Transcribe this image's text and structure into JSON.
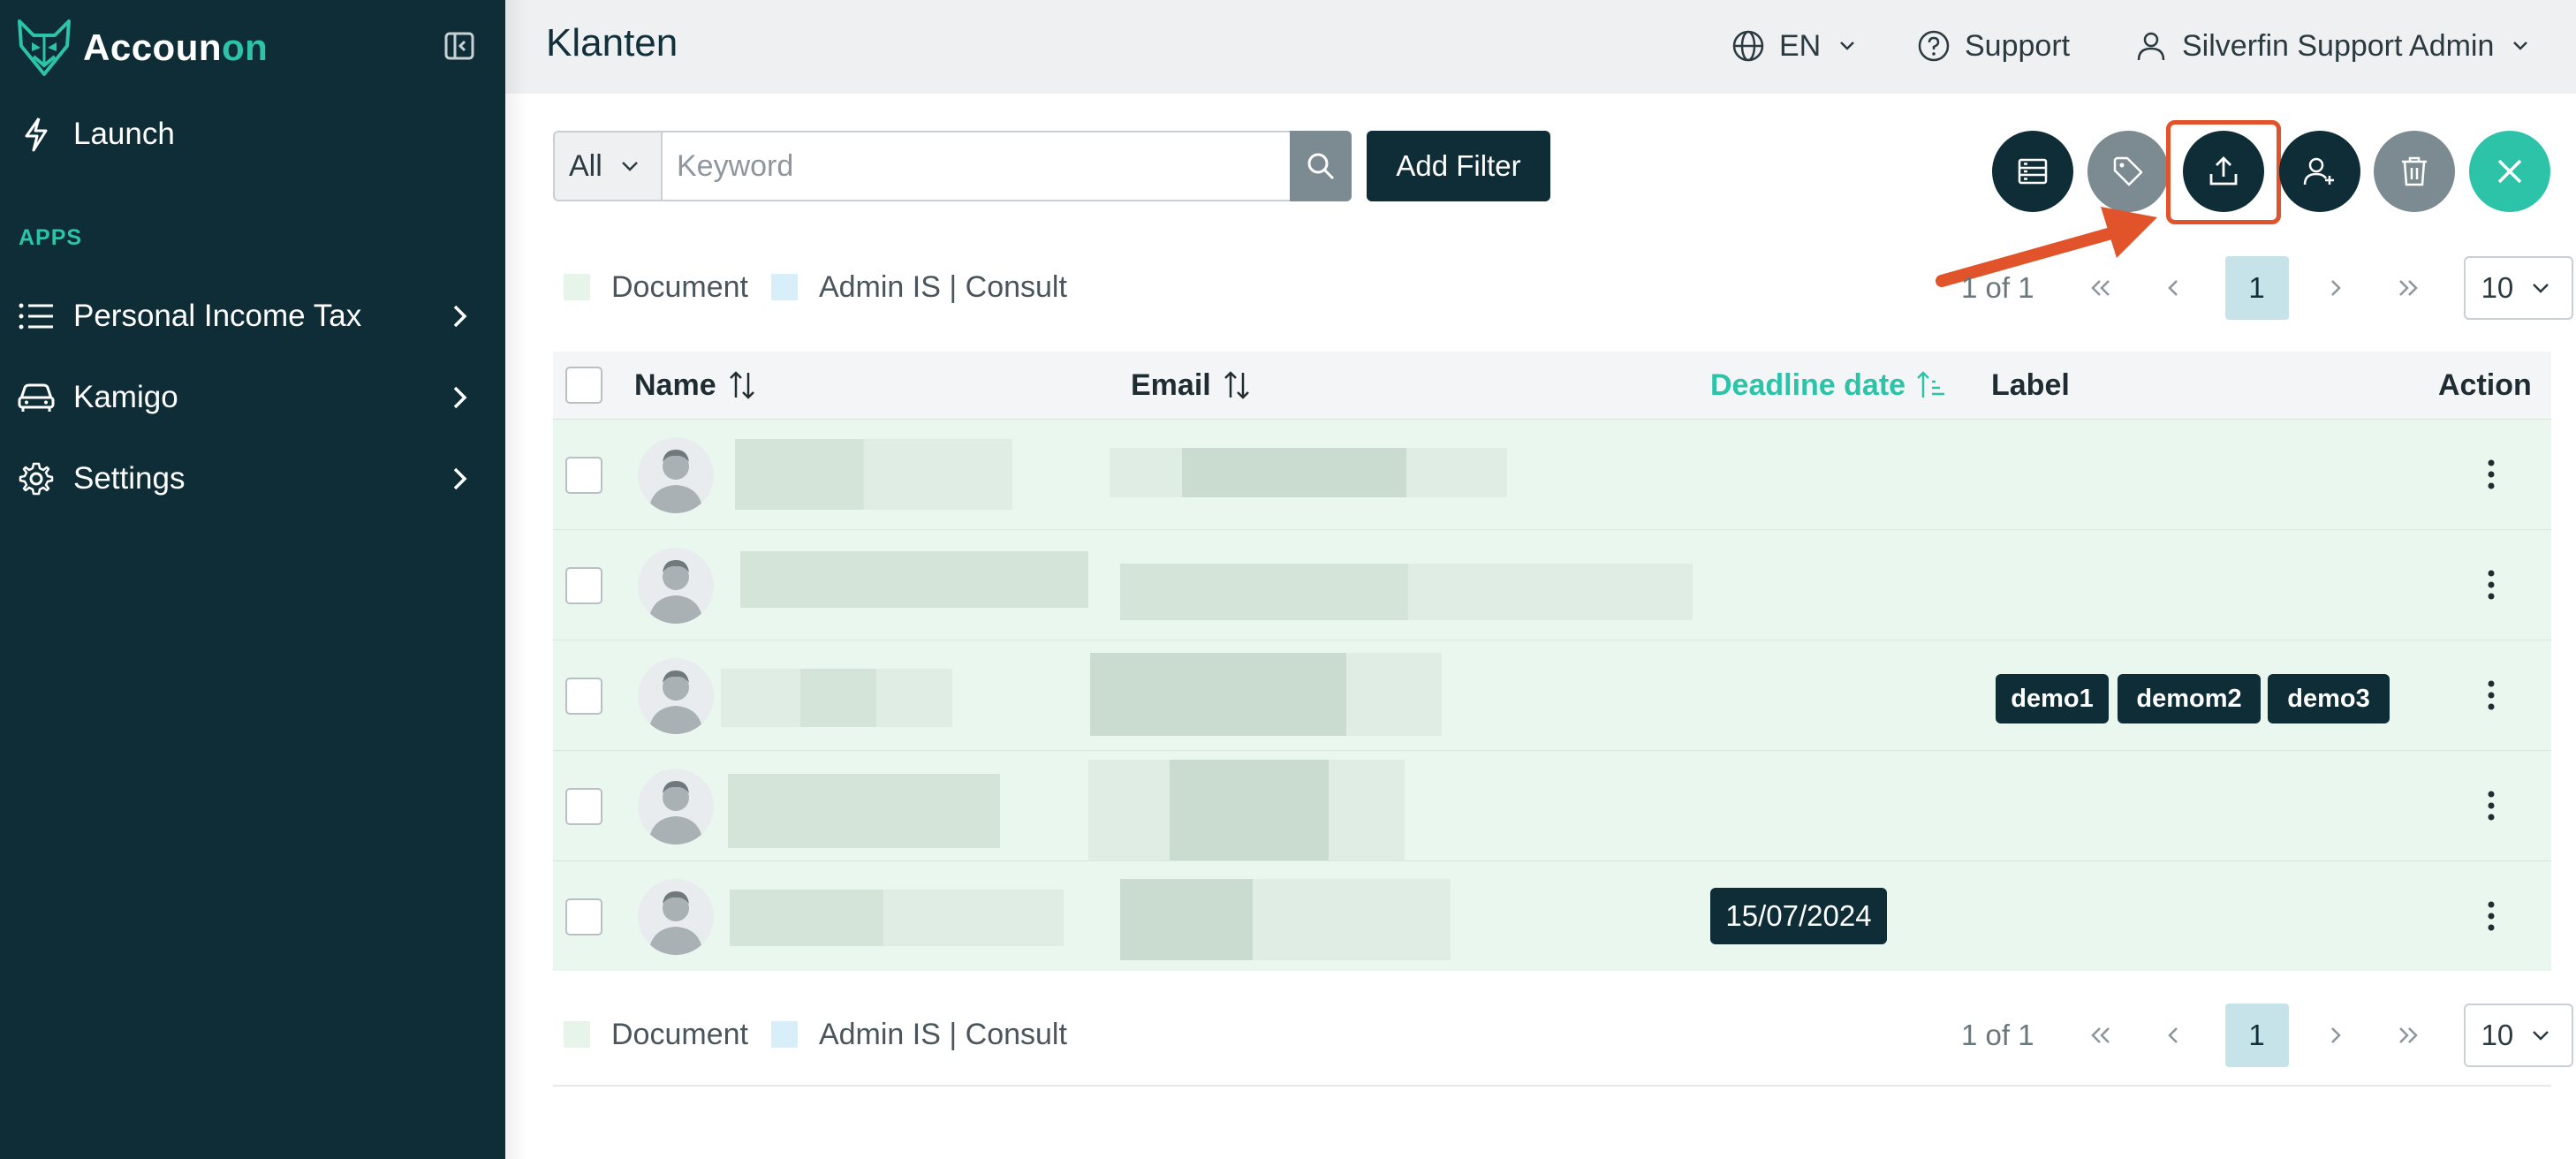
{
  "app": {
    "brand_prefix": "Accoun",
    "brand_suffix": "ton",
    "brand_accent": "on",
    "accent_color": "#2dc3a8",
    "sidebar_color": "#0e2d36"
  },
  "sidebar": {
    "launch_label": "Launch",
    "apps_heading": "APPS",
    "items": [
      {
        "label": "Personal Income Tax",
        "icon": "list-icon"
      },
      {
        "label": "Kamigo",
        "icon": "car-icon"
      },
      {
        "label": "Settings",
        "icon": "gear-icon"
      }
    ]
  },
  "topbar": {
    "title": "Klanten",
    "language": "EN",
    "support": "Support",
    "user": "Silverfin Support Admin"
  },
  "filter": {
    "scope_value": "All",
    "keyword_placeholder": "Keyword",
    "add_filter_label": "Add Filter"
  },
  "legend": {
    "item1": "Document",
    "item1_color": "#e6f4ea",
    "item2": "Admin IS | Consult",
    "item2_color": "#d8eef8"
  },
  "pagination": {
    "info": "1 of 1",
    "current_page": "1",
    "page_size": "10"
  },
  "table": {
    "columns": {
      "name": "Name",
      "email": "Email",
      "deadline": "Deadline date",
      "label": "Label",
      "action": "Action"
    },
    "rows": [
      {
        "labels": [],
        "deadline": ""
      },
      {
        "labels": [],
        "deadline": ""
      },
      {
        "labels": [
          "demo1",
          "demom2",
          "demo3"
        ],
        "deadline": ""
      },
      {
        "labels": [],
        "deadline": ""
      },
      {
        "labels": [],
        "deadline": "15/07/2024"
      }
    ]
  }
}
